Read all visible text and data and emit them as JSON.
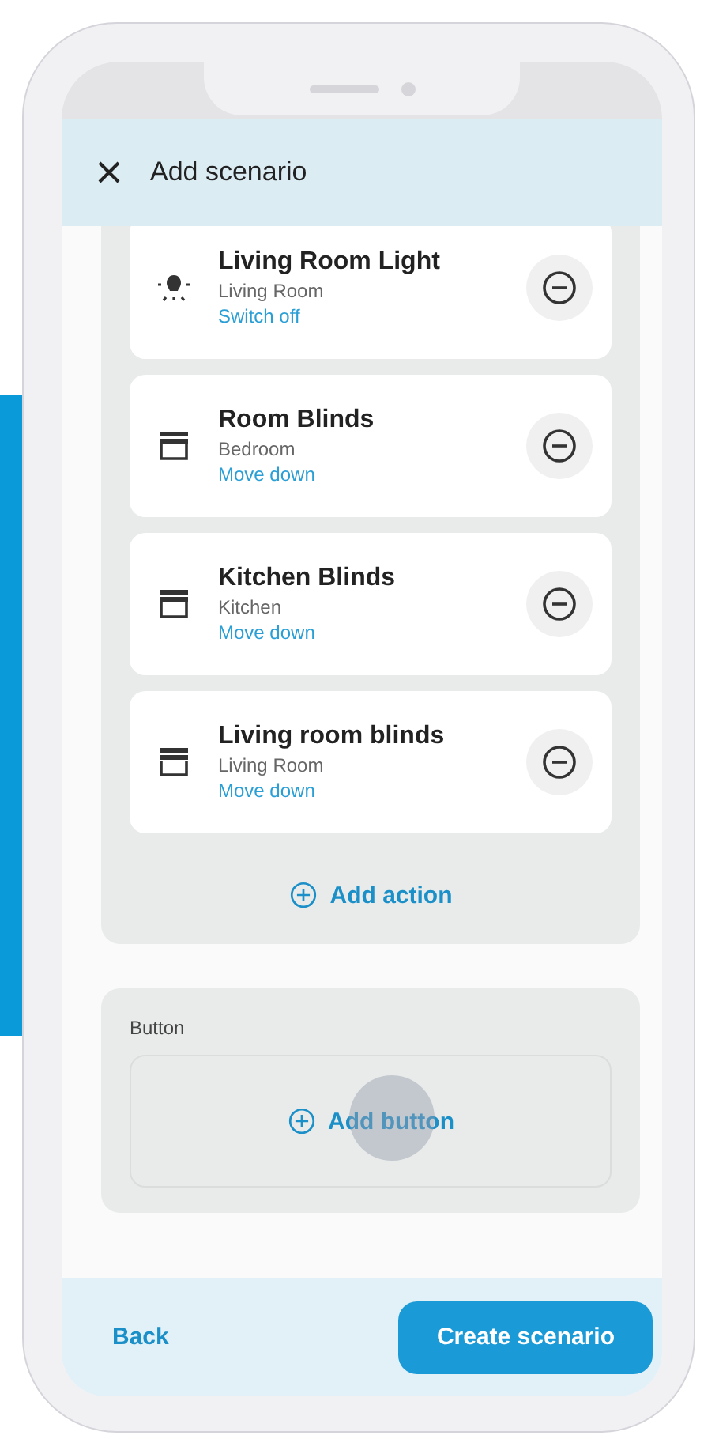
{
  "header": {
    "title": "Add scenario"
  },
  "actions": [
    {
      "kind": "light",
      "name": "Living Room Light",
      "room": "Living Room",
      "command": "Switch off"
    },
    {
      "kind": "blinds",
      "name": "Room Blinds",
      "room": "Bedroom",
      "command": "Move down"
    },
    {
      "kind": "blinds",
      "name": "Kitchen Blinds",
      "room": "Kitchen",
      "command": "Move down"
    },
    {
      "kind": "blinds",
      "name": "Living room blinds",
      "room": "Living Room",
      "command": "Move down"
    }
  ],
  "add_action": "Add action",
  "button_section": {
    "label": "Button",
    "add_button": "Add button"
  },
  "footer": {
    "back": "Back",
    "create": "Create scenario"
  }
}
